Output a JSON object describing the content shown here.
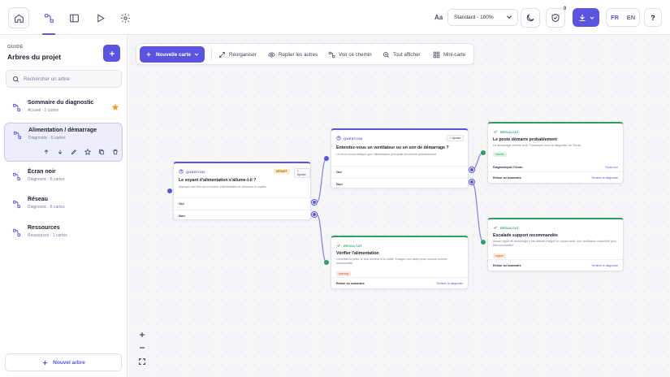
{
  "topbar": {
    "font_icon_label": "Aa",
    "zoom_select_value": "Standard - 100%",
    "badge_count": "0",
    "lang_fr": "FR",
    "lang_en": "EN",
    "help_label": "?",
    "nav_icons": [
      "home-icon",
      "tree-icon",
      "sidebar-icon",
      "play-icon",
      "gear-icon"
    ]
  },
  "sidebar": {
    "eyebrow": "GUIDE",
    "title": "Arbres du projet",
    "search_placeholder": "Rechercher un arbre",
    "new_tree_label": "Nouvel arbre",
    "items": [
      {
        "title": "Sommaire du diagnostic",
        "sub": "Accueil · 1 cartes",
        "starred": true
      },
      {
        "title": "Alimentation / démarrage",
        "sub": "Diagnostic · 5 cartes",
        "selected": true
      },
      {
        "title": "Écran noir",
        "sub": "Diagnostic · 5 cartes"
      },
      {
        "title": "Réseau",
        "sub": "Diagnostic · 6 cartes"
      },
      {
        "title": "Ressources",
        "sub": "Ressources · 1 cartes"
      }
    ]
  },
  "toolbar": {
    "new_card": "Nouvelle carte",
    "reorganize": "Réorganiser",
    "connect_others": "Replier les autres",
    "see_path": "Voir ce chemin",
    "show_all": "Tout afficher",
    "minimap": "Mini-carte"
  },
  "nodes": {
    "q1": {
      "kind": "QUESTION",
      "tag": "DÉPART",
      "opt": "+ Ajouter",
      "title": "Le voyant d'alimentation s'allume-t-il ?",
      "desc": "Appuyez une fois sur le bouton d'alimentation et observez le voyant.",
      "choice_yes": "Oui",
      "choice_no": "Non"
    },
    "q2": {
      "kind": "QUESTION",
      "opt": "+ Ajouter",
      "title": "Entendez-vous un ventilateur ou un son de démarrage ?",
      "desc": "Un bruit normal indique que l'alimentation principale fonctionne probablement.",
      "choice_yes": "Oui",
      "choice_no": "Non"
    },
    "r1": {
      "kind": "RÉSULTAT",
      "title": "Vérifier l'alimentation",
      "desc": "Contrôlez la prise, le bloc secteur et le câble. Essayez une autre prise connue comme fonctionnelle.",
      "tag": "warning",
      "back": "Retour au sommaire",
      "diag": "Terminer le diagnostic"
    },
    "r2": {
      "kind": "RÉSULTAT",
      "title": "Le poste démarre probablement",
      "desc": "Le démarrage semble actif. Poursuivez avec le diagnostic de l'écran.",
      "tag": "succès",
      "link_label": "Diagnostiquer l'écran",
      "link_action": "Écran noir",
      "back": "Retour au sommaire",
      "diag": "Terminer le diagnostic"
    },
    "r3": {
      "kind": "RÉSULTAT",
      "title": "Escalade support recommandée",
      "desc": "Aucun signe de démarrage n'est détecté malgré un voyant actif. Une vérification matérielle peut être nécessaire.",
      "tag": "urgent",
      "back": "Retour au sommaire",
      "diag": "Terminer le diagnostic"
    }
  },
  "colors": {
    "accent": "#5b54e0",
    "result": "#2f9e65",
    "star": "#f0a020"
  }
}
